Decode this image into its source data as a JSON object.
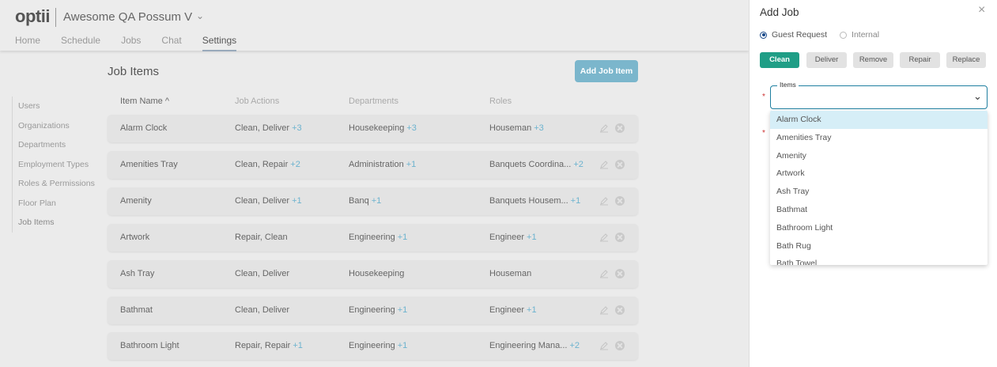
{
  "app": {
    "logo": "optii",
    "hotel_name": "Awesome QA Possum V",
    "nav": [
      {
        "label": "Home"
      },
      {
        "label": "Schedule"
      },
      {
        "label": "Jobs"
      },
      {
        "label": "Chat"
      },
      {
        "label": "Settings",
        "active": true
      }
    ]
  },
  "sidebar": {
    "items": [
      {
        "label": "Users"
      },
      {
        "label": "Organizations"
      },
      {
        "label": "Departments"
      },
      {
        "label": "Employment Types"
      },
      {
        "label": "Roles & Permissions"
      },
      {
        "label": "Floor Plan"
      },
      {
        "label": "Job Items",
        "active": true
      }
    ]
  },
  "main": {
    "title": "Job Items",
    "add_button": "Add Job Item",
    "columns": [
      "Item Name ^",
      "Job Actions",
      "Departments",
      "Roles"
    ],
    "rows": [
      {
        "name": "Alarm Clock",
        "actions": "Clean, Deliver",
        "actions_more": "+3",
        "dept": "Housekeeping",
        "dept_more": "+3",
        "role": "Houseman",
        "role_more": "+3"
      },
      {
        "name": "Amenities Tray",
        "actions": "Clean, Repair",
        "actions_more": "+2",
        "dept": "Administration",
        "dept_more": "+1",
        "role": "Banquets Coordina...",
        "role_more": "+2"
      },
      {
        "name": "Amenity",
        "actions": "Clean, Deliver",
        "actions_more": "+1",
        "dept": "Banq",
        "dept_more": "+1",
        "role": "Banquets Housem...",
        "role_more": "+1"
      },
      {
        "name": "Artwork",
        "actions": "Repair, Clean",
        "actions_more": "",
        "dept": "Engineering",
        "dept_more": "+1",
        "role": "Engineer",
        "role_more": "+1"
      },
      {
        "name": "Ash Tray",
        "actions": "Clean, Deliver",
        "actions_more": "",
        "dept": "Housekeeping",
        "dept_more": "",
        "role": "Houseman",
        "role_more": ""
      },
      {
        "name": "Bathmat",
        "actions": "Clean, Deliver",
        "actions_more": "",
        "dept": "Engineering",
        "dept_more": "+1",
        "role": "Engineer",
        "role_more": "+1"
      },
      {
        "name": "Bathroom Light",
        "actions": "Repair, Repair",
        "actions_more": "+1",
        "dept": "Engineering",
        "dept_more": "+1",
        "role": "Engineering Mana...",
        "role_more": "+2"
      }
    ]
  },
  "drawer": {
    "title": "Add Job",
    "close": "×",
    "radio": [
      {
        "label": "Guest Request",
        "checked": true
      },
      {
        "label": "Internal",
        "checked": false
      }
    ],
    "actions": [
      {
        "label": "Clean",
        "active": true
      },
      {
        "label": "Deliver"
      },
      {
        "label": "Remove"
      },
      {
        "label": "Repair"
      },
      {
        "label": "Replace"
      }
    ],
    "items_label": "Items",
    "options": [
      "Alarm Clock",
      "Amenities Tray",
      "Amenity",
      "Artwork",
      "Ash Tray",
      "Bathmat",
      "Bathroom Light",
      "Bath Rug",
      "Bath Towel"
    ]
  },
  "colors": {
    "accent": "#1f9e86",
    "add_button": "#7bb6cc",
    "more": "#6cb3cf",
    "highlight": "#d6eef7"
  }
}
